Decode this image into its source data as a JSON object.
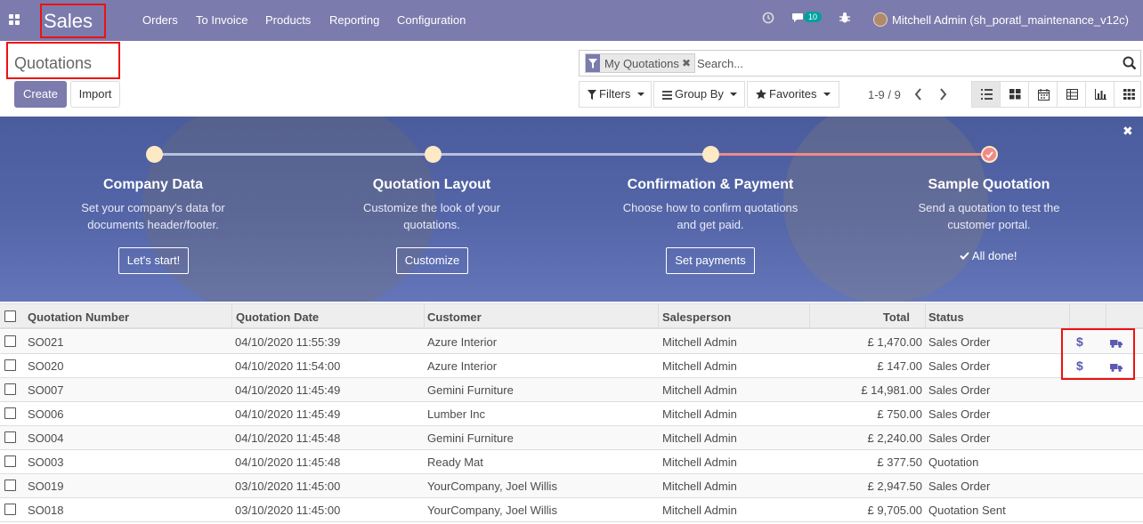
{
  "navbar": {
    "brand": "Sales",
    "menu": [
      "Orders",
      "To Invoice",
      "Products",
      "Reporting",
      "Configuration"
    ],
    "messages_count": "10",
    "user": "Mitchell Admin (sh_poratl_maintenance_v12c)"
  },
  "control": {
    "breadcrumb": "Quotations",
    "create_label": "Create",
    "import_label": "Import",
    "facet_label": "My Quotations",
    "search_placeholder": "Search...",
    "filters_label": "Filters",
    "groupby_label": "Group By",
    "favorites_label": "Favorites",
    "pager": "1-9 / 9",
    "views": [
      "list",
      "kanban",
      "calendar",
      "pivot",
      "graph",
      "activity"
    ]
  },
  "onboarding": {
    "steps": [
      {
        "title": "Company Data",
        "desc": [
          "Set your company's data for",
          "documents header/footer."
        ],
        "button": "Let's start!"
      },
      {
        "title": "Quotation Layout",
        "desc": [
          "Customize the look of your",
          "quotations."
        ],
        "button": "Customize"
      },
      {
        "title": "Confirmation & Payment",
        "desc": [
          "Choose how to confirm quotations",
          "and get paid."
        ],
        "button": "Set payments"
      },
      {
        "title": "Sample Quotation",
        "desc": [
          "Send a quotation to test the",
          "customer portal."
        ],
        "done": "All done!"
      }
    ]
  },
  "table": {
    "headers": [
      "Quotation Number",
      "Quotation Date",
      "Customer",
      "Salesperson",
      "Total",
      "Status"
    ],
    "rows": [
      {
        "number": "SO021",
        "date": "04/10/2020 11:55:39",
        "customer": "Azure Interior",
        "salesperson": "Mitchell Admin",
        "total": "£ 1,470.00",
        "status": "Sales Order",
        "actions": true
      },
      {
        "number": "SO020",
        "date": "04/10/2020 11:54:00",
        "customer": "Azure Interior",
        "salesperson": "Mitchell Admin",
        "total": "£ 147.00",
        "status": "Sales Order",
        "actions": true
      },
      {
        "number": "SO007",
        "date": "04/10/2020 11:45:49",
        "customer": "Gemini Furniture",
        "salesperson": "Mitchell Admin",
        "total": "£ 14,981.00",
        "status": "Sales Order"
      },
      {
        "number": "SO006",
        "date": "04/10/2020 11:45:49",
        "customer": "Lumber Inc",
        "salesperson": "Mitchell Admin",
        "total": "£ 750.00",
        "status": "Sales Order"
      },
      {
        "number": "SO004",
        "date": "04/10/2020 11:45:48",
        "customer": "Gemini Furniture",
        "salesperson": "Mitchell Admin",
        "total": "£ 2,240.00",
        "status": "Sales Order"
      },
      {
        "number": "SO003",
        "date": "04/10/2020 11:45:48",
        "customer": "Ready Mat",
        "salesperson": "Mitchell Admin",
        "total": "£ 377.50",
        "status": "Quotation"
      },
      {
        "number": "SO019",
        "date": "03/10/2020 11:45:00",
        "customer": "YourCompany, Joel Willis",
        "salesperson": "Mitchell Admin",
        "total": "£ 2,947.50",
        "status": "Sales Order"
      },
      {
        "number": "SO018",
        "date": "03/10/2020 11:45:00",
        "customer": "YourCompany, Joel Willis",
        "salesperson": "Mitchell Admin",
        "total": "£ 9,705.00",
        "status": "Quotation Sent"
      }
    ]
  },
  "colors": {
    "brand": "#7c7bad",
    "highlight": "#ee1111",
    "action_icon": "#5b5bb5"
  }
}
